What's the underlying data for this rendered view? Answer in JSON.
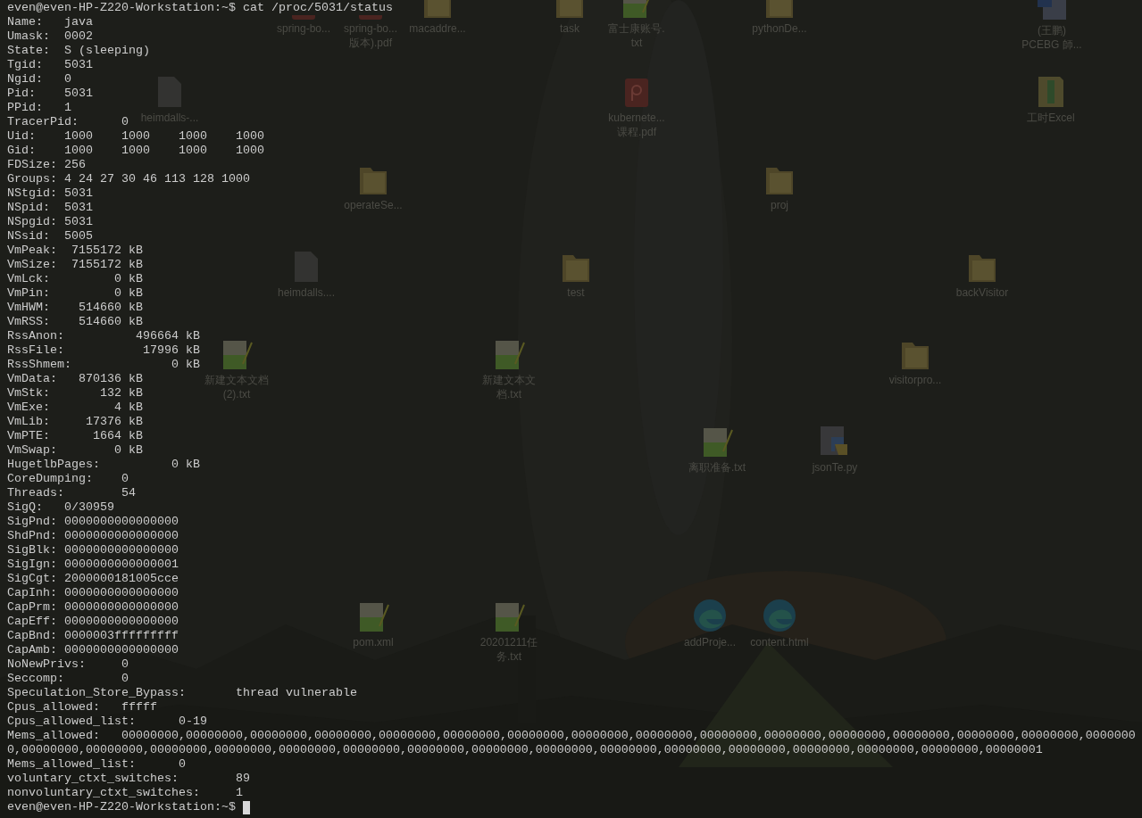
{
  "desktop": {
    "icons": [
      {
        "kind": "pdf",
        "lines": [
          "spring-bo..."
        ]
      },
      {
        "kind": "pdf",
        "lines": [
          "spring-bo...",
          "版本).pdf"
        ]
      },
      {
        "kind": "folder",
        "lines": [
          "macaddre..."
        ]
      },
      {
        "kind": "folder",
        "lines": [
          "task"
        ]
      },
      {
        "kind": "notepad",
        "lines": [
          "富士康账号.",
          "txt"
        ]
      },
      {
        "kind": "folder",
        "lines": [
          "pythonDe..."
        ]
      },
      {
        "kind": "word",
        "lines": [
          "(王鹏)",
          "PCEBG  師..."
        ]
      },
      {
        "kind": "file",
        "lines": [
          "heimdalls-..."
        ]
      },
      {
        "kind": "pdf",
        "lines": [
          "kubernete...",
          "课程.pdf"
        ]
      },
      {
        "kind": "excel",
        "lines": [
          "工时Excel"
        ]
      },
      {
        "kind": "folder",
        "lines": [
          "operateSe..."
        ]
      },
      {
        "kind": "folder",
        "lines": [
          "proj"
        ]
      },
      {
        "kind": "file",
        "lines": [
          "heimdalls...."
        ]
      },
      {
        "kind": "folder",
        "lines": [
          "test"
        ]
      },
      {
        "kind": "folder",
        "lines": [
          "backVisitor"
        ]
      },
      {
        "kind": "notepad",
        "lines": [
          "新建文本文档",
          "(2).txt"
        ]
      },
      {
        "kind": "notepad",
        "lines": [
          "新建文本文",
          "档.txt"
        ]
      },
      {
        "kind": "folder",
        "lines": [
          "visitorpro..."
        ]
      },
      {
        "kind": "notepad",
        "lines": [
          "离职准备.txt"
        ]
      },
      {
        "kind": "python",
        "lines": [
          "jsonTe.py"
        ]
      },
      {
        "kind": "notepad",
        "lines": [
          "pom.xml"
        ]
      },
      {
        "kind": "notepad",
        "lines": [
          "20201211任",
          "务.txt"
        ]
      },
      {
        "kind": "edge",
        "lines": [
          "addProje..."
        ]
      },
      {
        "kind": "edge",
        "lines": [
          "content.html"
        ]
      }
    ]
  },
  "terminal": {
    "lines": [
      {
        "kind": "command",
        "prompt": "even@even-HP-Z220-Workstation:~$",
        "command": "cat /proc/5031/status"
      },
      {
        "kind": "output",
        "text": "Name:\tjava"
      },
      {
        "kind": "output",
        "text": "Umask:\t0002"
      },
      {
        "kind": "output",
        "text": "State:\tS (sleeping)"
      },
      {
        "kind": "output",
        "text": "Tgid:\t5031"
      },
      {
        "kind": "output",
        "text": "Ngid:\t0"
      },
      {
        "kind": "output",
        "text": "Pid:\t5031"
      },
      {
        "kind": "output",
        "text": "PPid:\t1"
      },
      {
        "kind": "output",
        "text": "TracerPid:\t0"
      },
      {
        "kind": "output",
        "text": "Uid:\t1000\t1000\t1000\t1000"
      },
      {
        "kind": "output",
        "text": "Gid:\t1000\t1000\t1000\t1000"
      },
      {
        "kind": "output",
        "text": "FDSize:\t256"
      },
      {
        "kind": "output",
        "text": "Groups:\t4 24 27 30 46 113 128 1000"
      },
      {
        "kind": "output",
        "text": "NStgid:\t5031"
      },
      {
        "kind": "output",
        "text": "NSpid:\t5031"
      },
      {
        "kind": "output",
        "text": "NSpgid:\t5031"
      },
      {
        "kind": "output",
        "text": "NSsid:\t5005"
      },
      {
        "kind": "output",
        "text": "VmPeak:\t 7155172 kB"
      },
      {
        "kind": "output",
        "text": "VmSize:\t 7155172 kB"
      },
      {
        "kind": "output",
        "text": "VmLck:\t       0 kB"
      },
      {
        "kind": "output",
        "text": "VmPin:\t       0 kB"
      },
      {
        "kind": "output",
        "text": "VmHWM:\t  514660 kB"
      },
      {
        "kind": "output",
        "text": "VmRSS:\t  514660 kB"
      },
      {
        "kind": "output",
        "text": "RssAnon:\t  496664 kB"
      },
      {
        "kind": "output",
        "text": "RssFile:\t   17996 kB"
      },
      {
        "kind": "output",
        "text": "RssShmem:\t       0 kB"
      },
      {
        "kind": "output",
        "text": "VmData:\t  870136 kB"
      },
      {
        "kind": "output",
        "text": "VmStk:\t     132 kB"
      },
      {
        "kind": "output",
        "text": "VmExe:\t       4 kB"
      },
      {
        "kind": "output",
        "text": "VmLib:\t   17376 kB"
      },
      {
        "kind": "output",
        "text": "VmPTE:\t    1664 kB"
      },
      {
        "kind": "output",
        "text": "VmSwap:\t       0 kB"
      },
      {
        "kind": "output",
        "text": "HugetlbPages:\t       0 kB"
      },
      {
        "kind": "output",
        "text": "CoreDumping:\t0"
      },
      {
        "kind": "output",
        "text": "Threads:\t54"
      },
      {
        "kind": "output",
        "text": "SigQ:\t0/30959"
      },
      {
        "kind": "output",
        "text": "SigPnd:\t0000000000000000"
      },
      {
        "kind": "output",
        "text": "ShdPnd:\t0000000000000000"
      },
      {
        "kind": "output",
        "text": "SigBlk:\t0000000000000000"
      },
      {
        "kind": "output",
        "text": "SigIgn:\t0000000000000001"
      },
      {
        "kind": "output",
        "text": "SigCgt:\t2000000181005cce"
      },
      {
        "kind": "output",
        "text": "CapInh:\t0000000000000000"
      },
      {
        "kind": "output",
        "text": "CapPrm:\t0000000000000000"
      },
      {
        "kind": "output",
        "text": "CapEff:\t0000000000000000"
      },
      {
        "kind": "output",
        "text": "CapBnd:\t0000003fffffffff"
      },
      {
        "kind": "output",
        "text": "CapAmb:\t0000000000000000"
      },
      {
        "kind": "output",
        "text": "NoNewPrivs:\t0"
      },
      {
        "kind": "output",
        "text": "Seccomp:\t0"
      },
      {
        "kind": "output",
        "text": "Speculation_Store_Bypass:\tthread vulnerable"
      },
      {
        "kind": "output",
        "text": "Cpus_allowed:\tfffff"
      },
      {
        "kind": "output",
        "text": "Cpus_allowed_list:\t0-19"
      },
      {
        "kind": "output",
        "text": "Mems_allowed:\t00000000,00000000,00000000,00000000,00000000,00000000,00000000,00000000,00000000,00000000,00000000,00000000,00000000,00000000,00000000,0000000"
      },
      {
        "kind": "output",
        "text": "0,00000000,00000000,00000000,00000000,00000000,00000000,00000000,00000000,00000000,00000000,00000000,00000000,00000000,00000000,00000000,00000001"
      },
      {
        "kind": "output",
        "text": "Mems_allowed_list:\t0"
      },
      {
        "kind": "output",
        "text": "voluntary_ctxt_switches:\t89"
      },
      {
        "kind": "output",
        "text": "nonvoluntary_ctxt_switches:\t1"
      },
      {
        "kind": "prompt",
        "prompt": "even@even-HP-Z220-Workstation:~$"
      }
    ]
  }
}
